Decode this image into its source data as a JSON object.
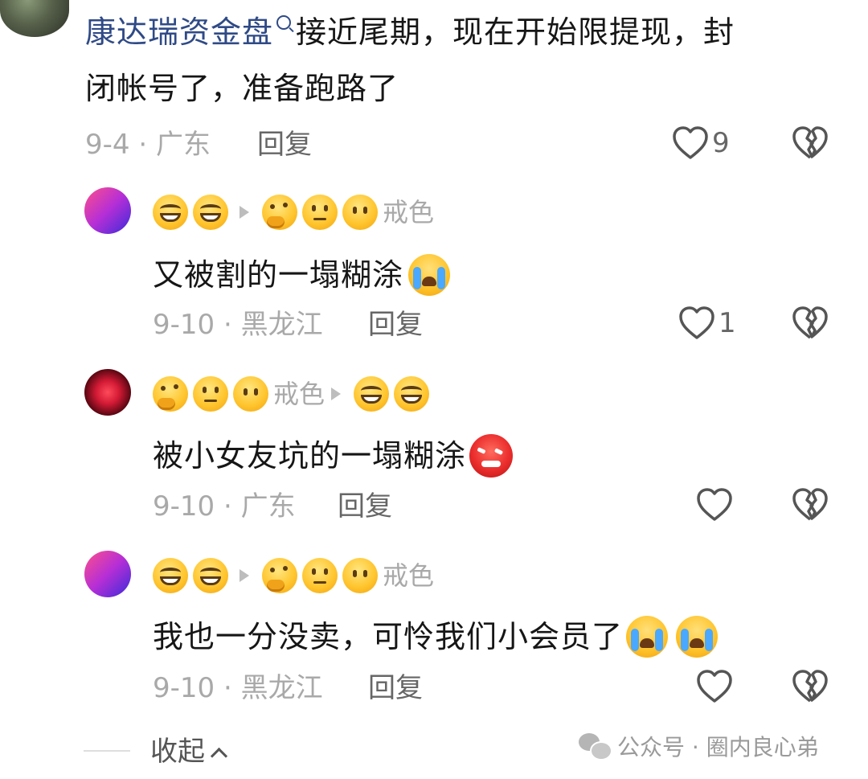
{
  "comments": [
    {
      "username": "康达瑞资金盘",
      "text_line1": "接近尾期，现在开始限提现，封",
      "text_line2": "闭帐号了，准备跑路了",
      "date_location": "9-4 · 广东",
      "reply_label": "回复",
      "like_count": "9"
    },
    {
      "name_suffix": "戒色",
      "text": "又被割的一塌糊涂",
      "date_location": "9-10 · 黑龙江",
      "reply_label": "回复",
      "like_count": "1"
    },
    {
      "name_suffix": "戒色",
      "text": "被小女友坑的一塌糊涂",
      "date_location": "9-10 · 广东",
      "reply_label": "回复",
      "like_count": ""
    },
    {
      "name_suffix": "戒色",
      "text": "我也一分没卖，可怜我们小会员了",
      "date_location": "9-10 · 黑龙江",
      "reply_label": "回复",
      "like_count": ""
    }
  ],
  "footer": {
    "collapse_label": "收起",
    "watermark": "公众号 · 圈内良心弟"
  },
  "colors": {
    "link": "#2f4a86",
    "meta": "#a9a9a9",
    "text": "#161616"
  }
}
